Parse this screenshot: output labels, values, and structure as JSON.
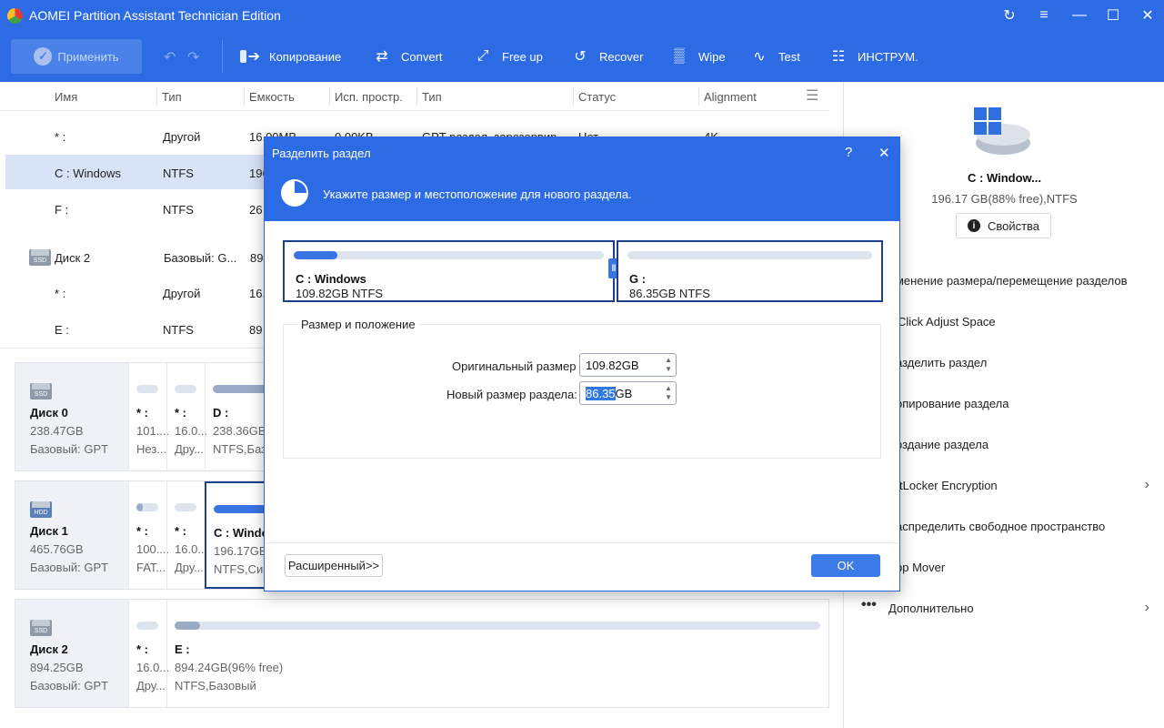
{
  "window": {
    "title": "AOMEI Partition Assistant Technician Edition"
  },
  "toolbar": {
    "apply_label": "Применить",
    "items": [
      {
        "label": "Копирование",
        "icon": "copy-icon"
      },
      {
        "label": "Convert",
        "icon": "convert-icon"
      },
      {
        "label": "Free up",
        "icon": "free-up-icon"
      },
      {
        "label": "Recover",
        "icon": "recover-icon"
      },
      {
        "label": "Wipe",
        "icon": "wipe-icon"
      },
      {
        "label": "Test",
        "icon": "test-icon"
      },
      {
        "label": "ИНСТРУМ.",
        "icon": "tools-icon"
      }
    ]
  },
  "table": {
    "headers": [
      "Имя",
      "Тип",
      "Емкость",
      "Исп. простр.",
      "Тип",
      "Статус",
      "Alignment"
    ],
    "rows": [
      {
        "name": "* :",
        "type": "Другой",
        "cap": "16.00MB",
        "used": "0.00KB",
        "ptype": "GPT раздел, зарезервир...",
        "status": "Нет",
        "align": "4K"
      },
      {
        "name": "C : Windows",
        "type": "NTFS",
        "cap": "196"
      },
      {
        "name": "F :",
        "type": "NTFS",
        "cap": "26"
      },
      {
        "name": "Диск 2",
        "type": "Базовый: G...",
        "cap": "894"
      },
      {
        "name": "* :",
        "type": "Другой",
        "cap": "16."
      },
      {
        "name": "E :",
        "type": "NTFS",
        "cap": "89"
      }
    ]
  },
  "disks": [
    {
      "name": "Диск 0",
      "size": "238.47GB",
      "type": "Базовый: GPT",
      "icon_label": "SSD",
      "parts": [
        {
          "label": "* :",
          "size": "101....",
          "type": "Нез...",
          "fill": 0
        },
        {
          "label": "* :",
          "size": "16.0...",
          "type": "Дру...",
          "fill": 0
        },
        {
          "label": "D :",
          "size": "238.36GB",
          "type": "NTFS,Баз",
          "fill": 1.0
        }
      ]
    },
    {
      "name": "Диск 1",
      "size": "465.76GB",
      "type": "Базовый: GPT",
      "icon_label": "HDD",
      "parts": [
        {
          "label": "* :",
          "size": "100....",
          "type": "FAT...",
          "fill": 0.3
        },
        {
          "label": "* :",
          "size": "16.0...",
          "type": "Дру...",
          "fill": 0
        },
        {
          "label": "C : Window",
          "size": "196.17GB(8",
          "type": "NTFS,Сис",
          "fill": 0.5
        }
      ]
    },
    {
      "name": "Диск 2",
      "size": "894.25GB",
      "type": "Базовый: GPT",
      "icon_label": "SSD",
      "parts": [
        {
          "label": "* :",
          "size": "16.0...",
          "type": "Дру...",
          "fill": 0
        },
        {
          "label": "E :",
          "size": "894.24GB(96% free)",
          "type": "NTFS,Базовый",
          "fill": 0.04
        }
      ]
    }
  ],
  "right_panel": {
    "title": "C : Window...",
    "subtitle": "196.17 GB(88% free),NTFS",
    "props_button": "Свойства",
    "ops": [
      {
        "label": "зменение размера/перемещение разделов"
      },
      {
        "label": "Click Adjust Space"
      },
      {
        "label": "азделить раздел"
      },
      {
        "label": "опирование раздела"
      },
      {
        "label": "оздание раздела"
      },
      {
        "label": "tLocker Encryption",
        "chevron": true
      },
      {
        "label": "аспределить свободное пространство"
      },
      {
        "label": "pp Mover"
      },
      {
        "label": "Дополнительно",
        "chevron": true
      }
    ]
  },
  "dialog": {
    "title": "Разделить раздел",
    "help": "?",
    "close": "✕",
    "header_text": "Укажите размер и местоположение для нового раздела.",
    "left_part": {
      "name": "C : Windows",
      "size": "109.82GB NTFS",
      "fill": 0.14
    },
    "right_part": {
      "name": "G :",
      "size": "86.35GB NTFS",
      "fill": 0
    },
    "group_title": "Размер и положение",
    "orig_label": "Оригинальный размер",
    "orig_value": "109.82GB",
    "new_label": "Новый размер раздела:",
    "new_value_sel": "86.35",
    "new_value_unit": "GB",
    "advanced": "Расширенный>>",
    "ok": "OK"
  }
}
